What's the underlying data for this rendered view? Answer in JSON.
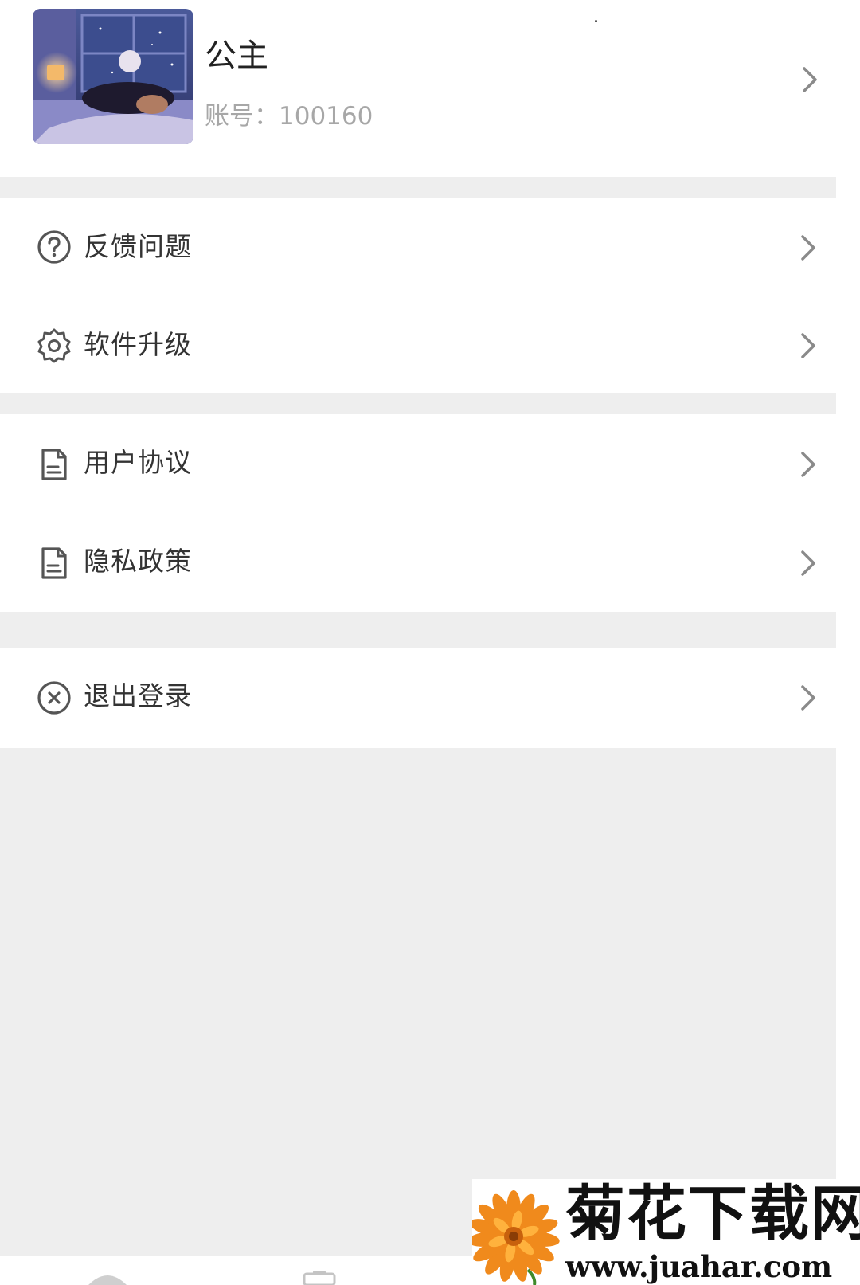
{
  "profile": {
    "name": "公主",
    "account": "账号：100160"
  },
  "menu": {
    "group1": [
      {
        "label": "反馈问题",
        "icon": "question-circle-icon"
      },
      {
        "label": "软件升级",
        "icon": "gear-icon"
      }
    ],
    "group2": [
      {
        "label": "用户协议",
        "icon": "document-icon"
      },
      {
        "label": "隐私政策",
        "icon": "document-icon"
      }
    ],
    "group3": [
      {
        "label": "退出登录",
        "icon": "close-circle-icon"
      }
    ]
  },
  "watermark": {
    "title": "菊花下载网",
    "url": "www.juahar.com"
  },
  "colors": {
    "background": "#eeeeee",
    "card": "#ffffff",
    "text": "#333333",
    "muted": "#a7a7a7",
    "icon": "#555555"
  }
}
